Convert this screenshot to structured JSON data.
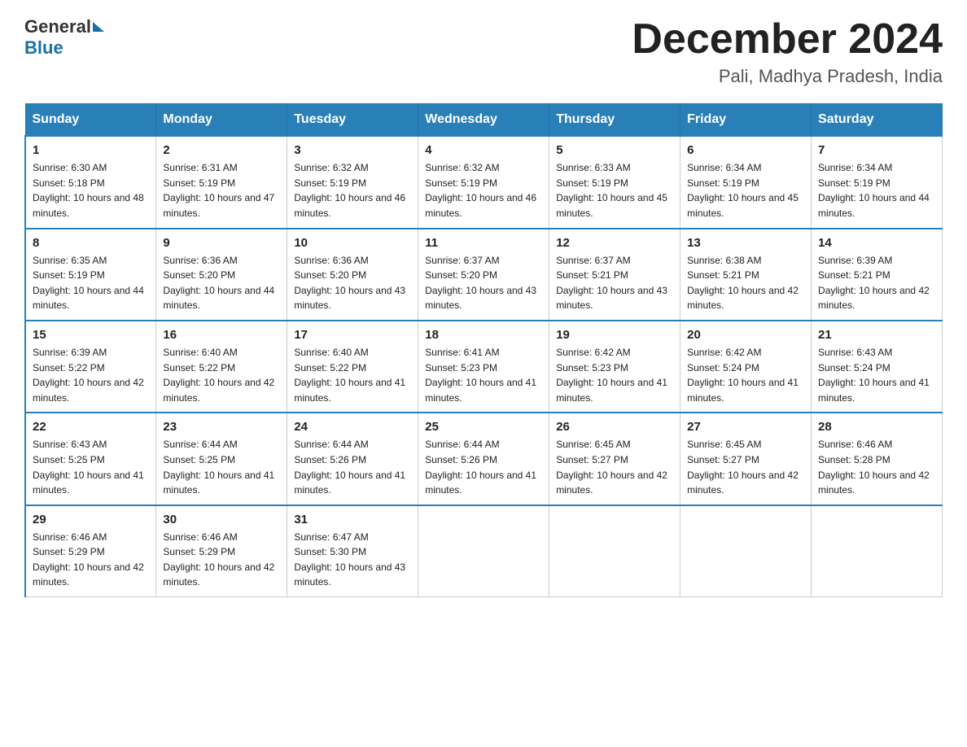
{
  "header": {
    "logo_general": "General",
    "logo_blue": "Blue",
    "title": "December 2024",
    "subtitle": "Pali, Madhya Pradesh, India"
  },
  "days_of_week": [
    "Sunday",
    "Monday",
    "Tuesday",
    "Wednesday",
    "Thursday",
    "Friday",
    "Saturday"
  ],
  "weeks": [
    [
      {
        "day": "1",
        "sunrise": "6:30 AM",
        "sunset": "5:18 PM",
        "daylight": "10 hours and 48 minutes."
      },
      {
        "day": "2",
        "sunrise": "6:31 AM",
        "sunset": "5:19 PM",
        "daylight": "10 hours and 47 minutes."
      },
      {
        "day": "3",
        "sunrise": "6:32 AM",
        "sunset": "5:19 PM",
        "daylight": "10 hours and 46 minutes."
      },
      {
        "day": "4",
        "sunrise": "6:32 AM",
        "sunset": "5:19 PM",
        "daylight": "10 hours and 46 minutes."
      },
      {
        "day": "5",
        "sunrise": "6:33 AM",
        "sunset": "5:19 PM",
        "daylight": "10 hours and 45 minutes."
      },
      {
        "day": "6",
        "sunrise": "6:34 AM",
        "sunset": "5:19 PM",
        "daylight": "10 hours and 45 minutes."
      },
      {
        "day": "7",
        "sunrise": "6:34 AM",
        "sunset": "5:19 PM",
        "daylight": "10 hours and 44 minutes."
      }
    ],
    [
      {
        "day": "8",
        "sunrise": "6:35 AM",
        "sunset": "5:19 PM",
        "daylight": "10 hours and 44 minutes."
      },
      {
        "day": "9",
        "sunrise": "6:36 AM",
        "sunset": "5:20 PM",
        "daylight": "10 hours and 44 minutes."
      },
      {
        "day": "10",
        "sunrise": "6:36 AM",
        "sunset": "5:20 PM",
        "daylight": "10 hours and 43 minutes."
      },
      {
        "day": "11",
        "sunrise": "6:37 AM",
        "sunset": "5:20 PM",
        "daylight": "10 hours and 43 minutes."
      },
      {
        "day": "12",
        "sunrise": "6:37 AM",
        "sunset": "5:21 PM",
        "daylight": "10 hours and 43 minutes."
      },
      {
        "day": "13",
        "sunrise": "6:38 AM",
        "sunset": "5:21 PM",
        "daylight": "10 hours and 42 minutes."
      },
      {
        "day": "14",
        "sunrise": "6:39 AM",
        "sunset": "5:21 PM",
        "daylight": "10 hours and 42 minutes."
      }
    ],
    [
      {
        "day": "15",
        "sunrise": "6:39 AM",
        "sunset": "5:22 PM",
        "daylight": "10 hours and 42 minutes."
      },
      {
        "day": "16",
        "sunrise": "6:40 AM",
        "sunset": "5:22 PM",
        "daylight": "10 hours and 42 minutes."
      },
      {
        "day": "17",
        "sunrise": "6:40 AM",
        "sunset": "5:22 PM",
        "daylight": "10 hours and 41 minutes."
      },
      {
        "day": "18",
        "sunrise": "6:41 AM",
        "sunset": "5:23 PM",
        "daylight": "10 hours and 41 minutes."
      },
      {
        "day": "19",
        "sunrise": "6:42 AM",
        "sunset": "5:23 PM",
        "daylight": "10 hours and 41 minutes."
      },
      {
        "day": "20",
        "sunrise": "6:42 AM",
        "sunset": "5:24 PM",
        "daylight": "10 hours and 41 minutes."
      },
      {
        "day": "21",
        "sunrise": "6:43 AM",
        "sunset": "5:24 PM",
        "daylight": "10 hours and 41 minutes."
      }
    ],
    [
      {
        "day": "22",
        "sunrise": "6:43 AM",
        "sunset": "5:25 PM",
        "daylight": "10 hours and 41 minutes."
      },
      {
        "day": "23",
        "sunrise": "6:44 AM",
        "sunset": "5:25 PM",
        "daylight": "10 hours and 41 minutes."
      },
      {
        "day": "24",
        "sunrise": "6:44 AM",
        "sunset": "5:26 PM",
        "daylight": "10 hours and 41 minutes."
      },
      {
        "day": "25",
        "sunrise": "6:44 AM",
        "sunset": "5:26 PM",
        "daylight": "10 hours and 41 minutes."
      },
      {
        "day": "26",
        "sunrise": "6:45 AM",
        "sunset": "5:27 PM",
        "daylight": "10 hours and 42 minutes."
      },
      {
        "day": "27",
        "sunrise": "6:45 AM",
        "sunset": "5:27 PM",
        "daylight": "10 hours and 42 minutes."
      },
      {
        "day": "28",
        "sunrise": "6:46 AM",
        "sunset": "5:28 PM",
        "daylight": "10 hours and 42 minutes."
      }
    ],
    [
      {
        "day": "29",
        "sunrise": "6:46 AM",
        "sunset": "5:29 PM",
        "daylight": "10 hours and 42 minutes."
      },
      {
        "day": "30",
        "sunrise": "6:46 AM",
        "sunset": "5:29 PM",
        "daylight": "10 hours and 42 minutes."
      },
      {
        "day": "31",
        "sunrise": "6:47 AM",
        "sunset": "5:30 PM",
        "daylight": "10 hours and 43 minutes."
      },
      null,
      null,
      null,
      null
    ]
  ]
}
